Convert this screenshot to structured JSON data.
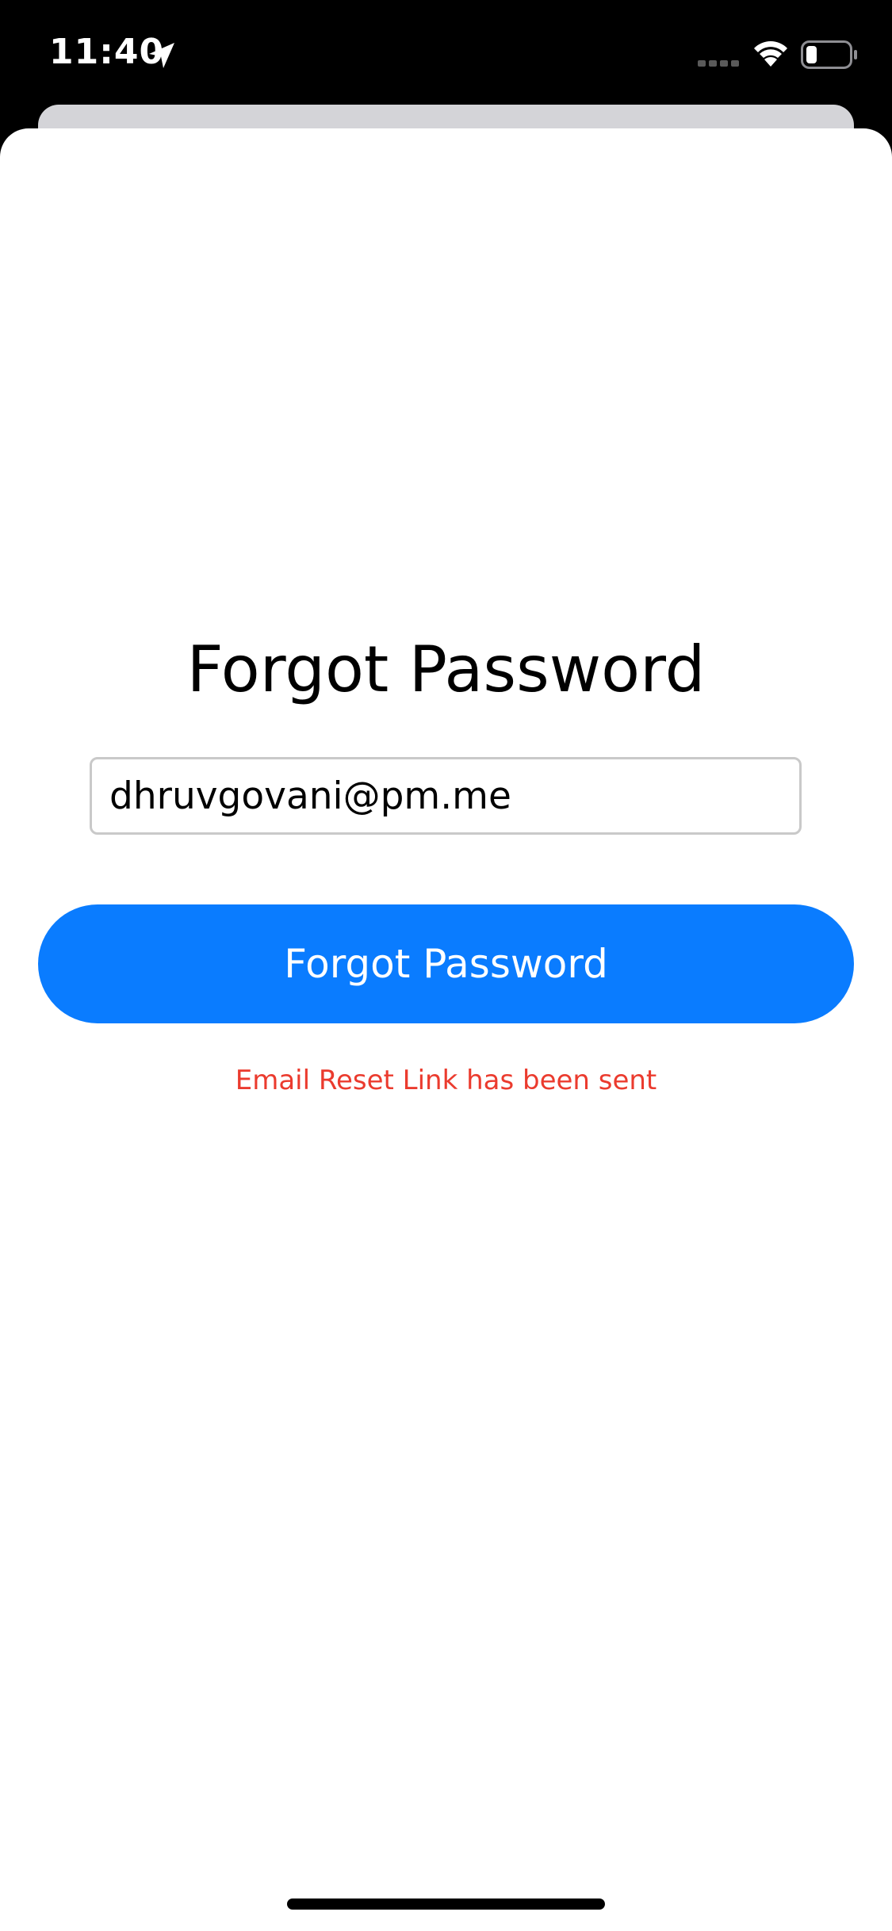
{
  "status_bar": {
    "time": "11:40",
    "icons": [
      "location-arrow-icon",
      "cellular-signal-icon",
      "wifi-icon",
      "battery-icon"
    ]
  },
  "forgot_password": {
    "title": "Forgot Password",
    "email_value": "dhruvgovani@pm.me",
    "button_label": "Forgot Password",
    "status_message": "Email Reset Link has been sent"
  },
  "colors": {
    "accent": "#0a7cff",
    "error_text": "#eb3b2e",
    "field_border": "#c9c9c9",
    "sheet_background": "#ffffff",
    "back_sheet": "#d4d4d8"
  }
}
